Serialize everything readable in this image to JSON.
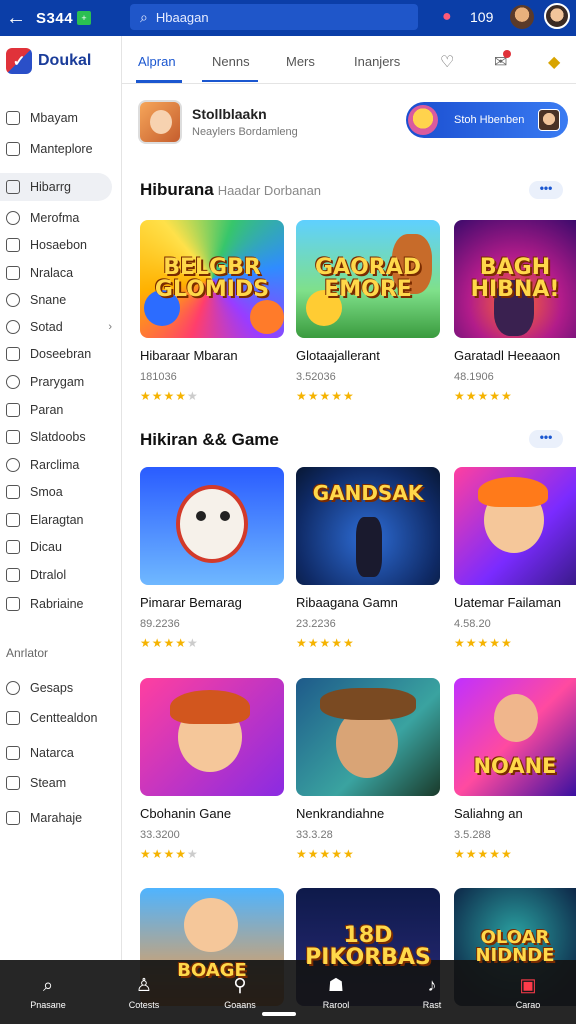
{
  "topbar": {
    "brand": "S344",
    "chip": "+",
    "search_placeholder": "Hbaagan",
    "time": "109"
  },
  "sidebar": {
    "logo": "Doukal",
    "items": [
      {
        "label": "Mbayam"
      },
      {
        "label": "Manteplore"
      },
      {
        "label": "Hibarrg"
      },
      {
        "label": "Merofma"
      },
      {
        "label": "Hosaebon"
      },
      {
        "label": "Nralaca"
      },
      {
        "label": "Snane"
      },
      {
        "label": "Sotad"
      },
      {
        "label": "Doseebran"
      },
      {
        "label": "Prarygam"
      },
      {
        "label": "Paran"
      },
      {
        "label": "Slatdoobs"
      },
      {
        "label": "Rarclima"
      },
      {
        "label": "Smoa"
      },
      {
        "label": "Elaragtan"
      },
      {
        "label": "Dicau"
      },
      {
        "label": "Dtralol"
      },
      {
        "label": "Rabriaine"
      }
    ],
    "section_label": "Anrlator",
    "items2": [
      {
        "label": "Gesaps"
      },
      {
        "label": "Centtealdon"
      },
      {
        "label": "Natarca"
      },
      {
        "label": "Steam"
      },
      {
        "label": "Marahaje"
      }
    ]
  },
  "tabs": [
    {
      "label": "Alpran"
    },
    {
      "label": "Nenns"
    },
    {
      "label": "Mers"
    },
    {
      "label": "Inanjers"
    }
  ],
  "profile": {
    "name": "Stollblaakn",
    "subtitle": "Neaylers Bordamleng",
    "button_label": "Stoh Hbenben"
  },
  "sections": [
    {
      "title": "Hiburana",
      "subtitle": "Haadar Dorbanan",
      "more": "•••",
      "cards": [
        {
          "art": "BELGBR GLOMIDS",
          "title": "Hibaraar Mbaran",
          "meta": "181036",
          "stars": "★★★★",
          "stars_off": "★"
        },
        {
          "art": "GAORAD EMORE",
          "title": "Glotaajallerant",
          "meta": "3.52036",
          "stars": "★★★★★",
          "stars_off": ""
        },
        {
          "art": "BAGH HIBNA!",
          "title": "Garatadl Heeaaon",
          "meta": "48.1906",
          "stars": "★★★★★",
          "stars_off": ""
        }
      ]
    },
    {
      "title": "Hikiran && Game",
      "subtitle": "",
      "more": "•••",
      "cards": [
        {
          "art": "",
          "title": "Pimarar Bemarag",
          "meta": "89.2236",
          "stars": "★★★★",
          "stars_off": "★"
        },
        {
          "art": "GANDSAK",
          "title": "Ribaagana Gamn",
          "meta": "23.2236",
          "stars": "★★★★★",
          "stars_off": ""
        },
        {
          "art": "",
          "title": "Uatemar Failaman",
          "meta": "4.58.20",
          "stars": "★★★★★",
          "stars_off": ""
        }
      ]
    },
    {
      "title": "",
      "subtitle": "",
      "more": "",
      "cards": [
        {
          "art": "",
          "title": "Cbohanin Gane",
          "meta": "33.3200",
          "stars": "★★★★",
          "stars_off": "★"
        },
        {
          "art": "",
          "title": "Nenkrandiahne",
          "meta": "33.3.28",
          "stars": "★★★★★",
          "stars_off": ""
        },
        {
          "art": "NOANE",
          "title": "Saliahng an",
          "meta": "3.5.288",
          "stars": "★★★★★",
          "stars_off": ""
        }
      ]
    },
    {
      "title": "",
      "subtitle": "",
      "more": "",
      "cards": [
        {
          "art": "BOAGE",
          "title": "",
          "meta": "",
          "stars": "",
          "stars_off": ""
        },
        {
          "art": "18D PIKORBAS",
          "title": "",
          "meta": "",
          "stars": "",
          "stars_off": ""
        },
        {
          "art": "OLOAR NIDNDE",
          "title": "",
          "meta": "",
          "stars": "",
          "stars_off": ""
        }
      ]
    }
  ],
  "bottomnav": [
    {
      "label": "Pnasane",
      "icon": "search-icon"
    },
    {
      "label": "Cotests",
      "icon": "person-icon"
    },
    {
      "label": "Goaans",
      "icon": "pin-icon"
    },
    {
      "label": "Rarool",
      "icon": "game-icon"
    },
    {
      "label": "Rast",
      "icon": "music-icon"
    },
    {
      "label": "Carao",
      "icon": "video-icon"
    }
  ]
}
